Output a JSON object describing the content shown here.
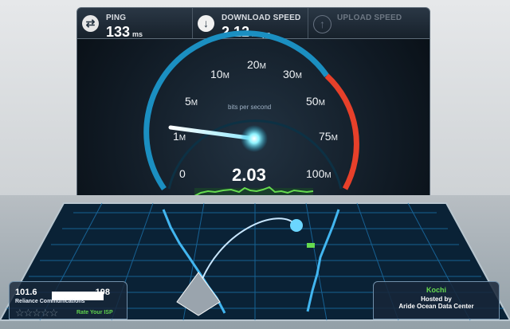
{
  "stats": {
    "ping_label": "PING",
    "ping_value": "133",
    "ping_unit": "ms",
    "download_label": "DOWNLOAD SPEED",
    "download_value": "2.12",
    "download_unit": "Mbps",
    "upload_label": "UPLOAD SPEED"
  },
  "gauge": {
    "label": "bits per second",
    "value": "2.03",
    "ticks": [
      {
        "label": "0",
        "unit": ""
      },
      {
        "label": "1",
        "unit": "M"
      },
      {
        "label": "5",
        "unit": "M"
      },
      {
        "label": "10",
        "unit": "M"
      },
      {
        "label": "20",
        "unit": "M"
      },
      {
        "label": "30",
        "unit": "M"
      },
      {
        "label": "50",
        "unit": "M"
      },
      {
        "label": "75",
        "unit": "M"
      },
      {
        "label": "100",
        "unit": "M"
      }
    ]
  },
  "location": {
    "ip_prefix": "101.6",
    "ip_suffix": ".198",
    "isp": "Reliance Communications",
    "stars": "☆☆☆☆☆",
    "rate_label": "Rate Your ISP"
  },
  "server": {
    "city": "Kochi",
    "hosted_by": "Hosted by",
    "name": "Aride Ocean Data Center"
  },
  "colors": {
    "gauge_blue": "#1b8fc1",
    "gauge_red": "#e7402a",
    "map_green": "#66db4f"
  },
  "icons": {
    "ping": "exchange-icon",
    "download": "download-arrow-icon",
    "upload": "upload-arrow-icon"
  }
}
